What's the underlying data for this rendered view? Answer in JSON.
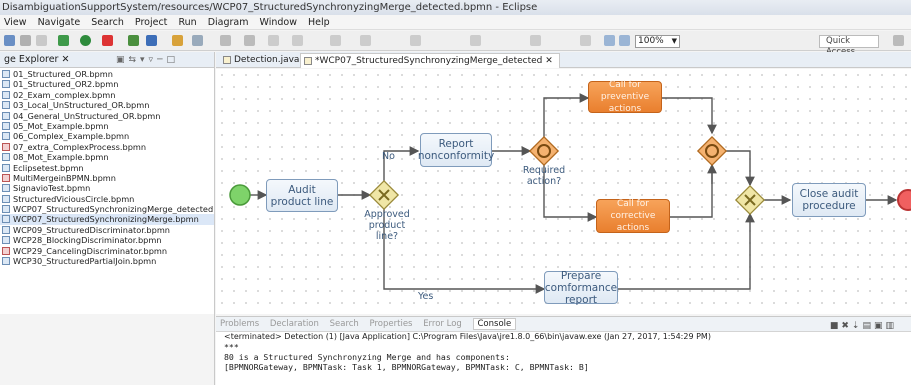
{
  "window": {
    "title": "DisambiguationSupportSystem/resources/WCP07_StructuredSynchronyzingMerge_detected.bpmn - Eclipse"
  },
  "menu": [
    "View",
    "Navigate",
    "Search",
    "Project",
    "Run",
    "Diagram",
    "Window",
    "Help"
  ],
  "toolbar": {
    "zoom": "100%",
    "quick_access": "Quick Access"
  },
  "explorer": {
    "title": "ge Explorer",
    "files": [
      "01_Structured_OR.bpmn",
      "01_Structured_OR2.bpmn",
      "02_Exam_complex.bpmn",
      "03_Local_UnStructured_OR.bpmn",
      "04_General_UnStructured_OR.bpmn",
      "05_Mot_Example.bpmn",
      "06_Complex_Example.bpmn",
      "07_extra_ComplexProcess.bpmn",
      "08_Mot_Example.bpmn",
      "Eclipsetest.bpmn",
      "MultiMergeinBPMN.bpmn",
      "SignavioTest.bpmn",
      "StructuredViciousCircle.bpmn",
      "WCP07_StructuredSynchronizingMerge_detected.bpm",
      "WCP07_StructuredSynchronizingMerge.bpmn",
      "WCP09_StructuredDiscriminator.bpmn",
      "WCP28_BlockingDiscriminator.bpmn",
      "WCP29_CancelingDiscriminator.bpmn",
      "WCP30_StructuredPartialJoin.bpmn"
    ]
  },
  "tabs": [
    "Detection.java",
    "*WCP07_StructuredSynchronyzingMerge_detected"
  ],
  "diagram": {
    "audit": "Audit product line",
    "report": "Report nonconformity",
    "prepare": "Prepare comformance report",
    "preventive": "Call for preventive actions",
    "corrective": "Call for corrective actions",
    "close": "Close audit procedure",
    "approved": "Approved product line?",
    "required": "Required action?",
    "no": "No",
    "yes": "Yes"
  },
  "console": {
    "tabs": [
      "Problems",
      "Declaration",
      "Search",
      "Properties",
      "Error Log",
      "Console"
    ],
    "terminated": "<terminated> Detection (1) [Java Application] C:\\Program Files\\Java\\jre1.8.0_66\\bin\\javaw.exe (Jan 27, 2017, 1:54:29 PM)",
    "stars": "***",
    "line1": "80 is a Structured Synchronyzing Merge and has components:",
    "line2": "[BPMNORGateway, BPMNTask: Task 1, BPMNORGateway, BPMNTask: C, BPMNTask: B]"
  }
}
